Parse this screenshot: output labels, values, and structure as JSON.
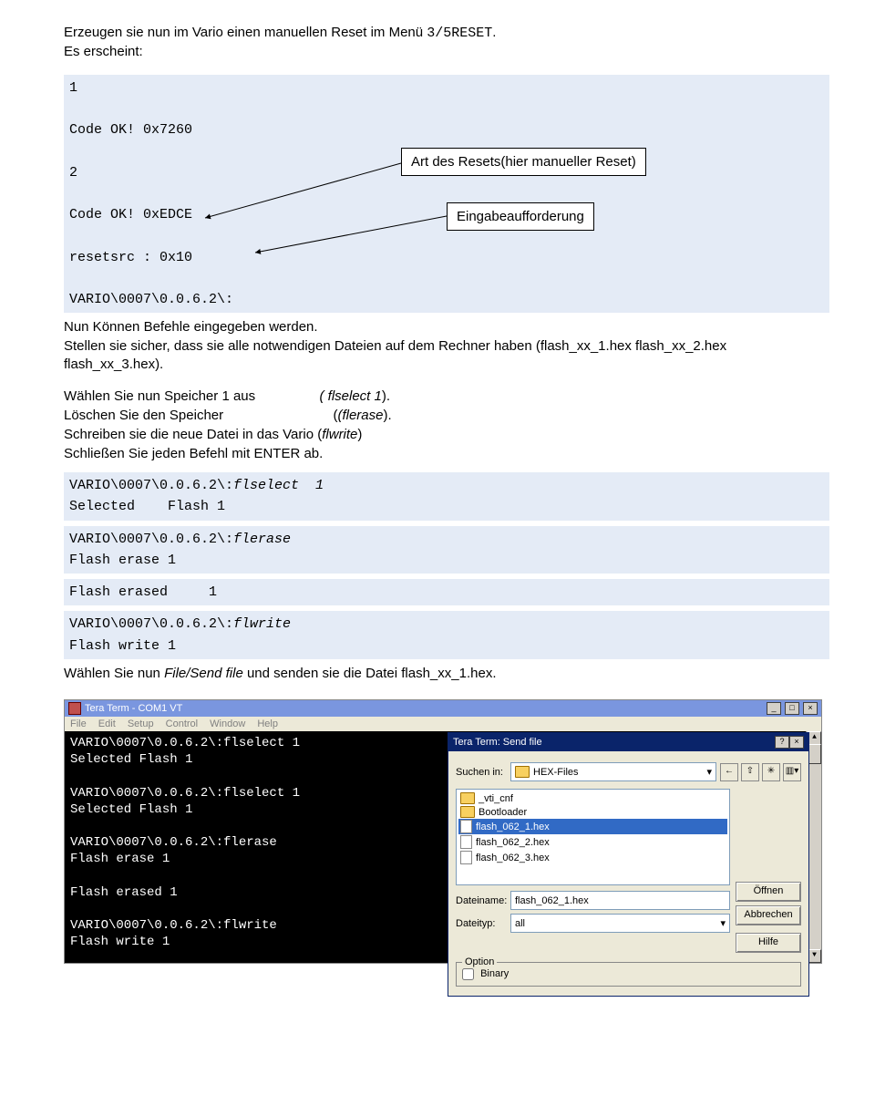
{
  "intro": {
    "line1a": "Erzeugen sie nun im Vario einen manuellen Reset im Menü ",
    "line1b": "3/5RESET",
    "line1c": ".",
    "line2": "Es erscheint:"
  },
  "code1": {
    "l1": "1",
    "l2": "Code OK! 0x7260",
    "l3": "2",
    "l4": "Code OK! 0xEDCE",
    "l5": "resetsrc : 0x10",
    "l6": "VARIO\\0007\\0.0.6.2\\:"
  },
  "callout1": "Art des Resets(hier manueller Reset)",
  "callout2": "Eingabeaufforderung",
  "para2a": "Nun Können Befehle eingegeben werden.",
  "para2b": "Stellen sie sicher, dass sie alle notwendigen Dateien auf dem Rechner haben (flash_xx_1.hex flash_xx_2.hex flash_xx_3.hex).",
  "steps": {
    "s1a": "Wählen Sie nun Speicher 1 aus",
    "s1b": "( flselect 1",
    "s1c": ").",
    "s2a": "Löschen Sie den Speicher",
    "s2b": "(flerase",
    "s2c": ").",
    "s3a": "Schreiben sie die neue Datei in das Vario (",
    "s3b": "flwrite",
    "s3c": ")",
    "s4": "Schließen Sie jeden Befehl mit ENTER ab."
  },
  "code2": {
    "a1": "VARIO\\0007\\0.0.6.2\\:",
    "a1i": "flselect  1",
    "a2": "Selected    Flash 1",
    "b1": "VARIO\\0007\\0.0.6.2\\:",
    "b1i": "flerase",
    "b2": "Flash erase 1",
    "b3": "Flash erased     1",
    "c1": "VARIO\\0007\\0.0.6.2\\:",
    "c1i": "flwrite",
    "c2": "Flash write 1"
  },
  "para3a": "Wählen Sie nun ",
  "para3b": "File/Send file",
  "para3c": " und senden sie die Datei flash_xx_1.hex.",
  "screenshot": {
    "title": "Tera Term - COM1 VT",
    "menu": [
      "File",
      "Edit",
      "Setup",
      "Control",
      "Window",
      "Help"
    ],
    "term": {
      "l1": "VARIO\\0007\\0.0.6.2\\:flselect 1",
      "l2": "Selected Flash 1",
      "l3": "VARIO\\0007\\0.0.6.2\\:flselect 1",
      "l4": "Selected Flash 1",
      "l5": "VARIO\\0007\\0.0.6.2\\:flerase",
      "l6": "Flash erase 1",
      "l7": "Flash erased 1",
      "l8": "VARIO\\0007\\0.0.6.2\\:flwrite",
      "l9": "Flash write 1"
    },
    "dialog": {
      "title": "Tera Term: Send file",
      "lookin_label": "Suchen in:",
      "lookin_value": "HEX-Files",
      "files": [
        {
          "name": "_vti_cnf",
          "type": "folder"
        },
        {
          "name": "Bootloader",
          "type": "folder"
        },
        {
          "name": "flash_062_1.hex",
          "type": "hex",
          "selected": true
        },
        {
          "name": "flash_062_2.hex",
          "type": "hex"
        },
        {
          "name": "flash_062_3.hex",
          "type": "hex"
        }
      ],
      "filename_label": "Dateiname:",
      "filename_value": "flash_062_1.hex",
      "filetype_label": "Dateityp:",
      "filetype_value": "all",
      "btn_open": "Öffnen",
      "btn_cancel": "Abbrechen",
      "btn_help": "Hilfe",
      "group_label": "Option",
      "checkbox_label": "Binary"
    }
  }
}
